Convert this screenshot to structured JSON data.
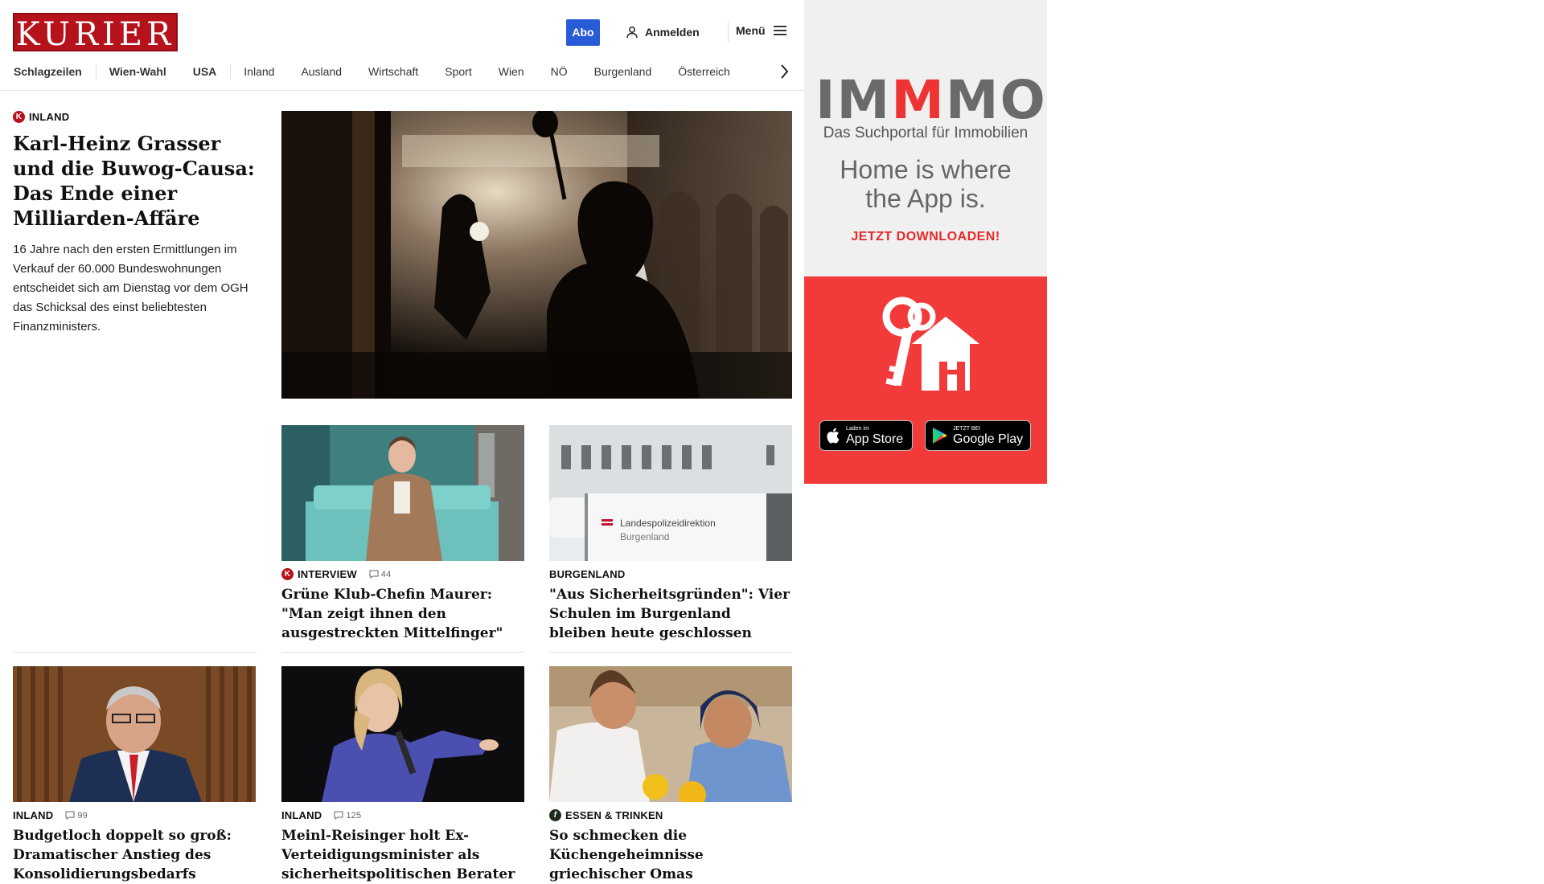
{
  "brand": {
    "logo_text": "KURIER",
    "accent": "#b5121b"
  },
  "header": {
    "abo_label": "Abo",
    "login_label": "Anmelden",
    "menu_label": "Menü"
  },
  "nav": {
    "items": [
      "Schlagzeilen",
      "Wien-Wahl",
      "USA",
      "Inland",
      "Ausland",
      "Wirtschaft",
      "Sport",
      "Wien",
      "NÖ",
      "Burgenland",
      "Österreich"
    ]
  },
  "lead": {
    "kicker": "INLAND",
    "title": "Karl-Heinz Grasser und die Buwog-Causa: Das Ende einer Milliarden-Affäre",
    "teaser": "16 Jahre nach den ersten Ermittlungen im Verkauf der 60.000 Bundeswohnungen entscheidet sich am Dienstag vor dem OGH das Schicksal des einst beliebtesten Finanzministers."
  },
  "articles": [
    {
      "kicker": "INTERVIEW",
      "comments": "44",
      "title": "Grüne Klub-Chefin Maurer: \"Man zeigt ihnen den ausgestreckten Mittelfinger\""
    },
    {
      "kicker": "BURGENLAND",
      "title": "\"Aus Sicherheitsgründen\": Vier Schulen im Burgenland bleiben heute geschlossen",
      "sign_line1": "Landespolizeidirektion",
      "sign_line2": "Burgenland"
    },
    {
      "kicker": "INLAND",
      "comments": "99",
      "title": "Budgetloch doppelt so groß: Dramatischer Anstieg des Konsolidierungsbedarfs"
    },
    {
      "kicker": "INLAND",
      "comments": "125",
      "title": "Meinl-Reisinger holt Ex-Verteidigungsminister als sicherheitspolitischen Berater"
    },
    {
      "kicker": "ESSEN & TRINKEN",
      "title": "So schmecken die Küchengeheimnisse griechischer Omas"
    }
  ],
  "ad": {
    "logo_parts": [
      "IM",
      "M",
      "MO"
    ],
    "subtitle": "Das Suchportal für Immobilien",
    "claim_line1": "Home is where",
    "claim_line2": "the App is.",
    "cta": "JETZT DOWNLOADEN!",
    "appstore_small": "Laden im",
    "appstore_large": "App Store",
    "play_small": "JETZT BEI",
    "play_large": "Google Play",
    "accent": "#f33a3a"
  }
}
